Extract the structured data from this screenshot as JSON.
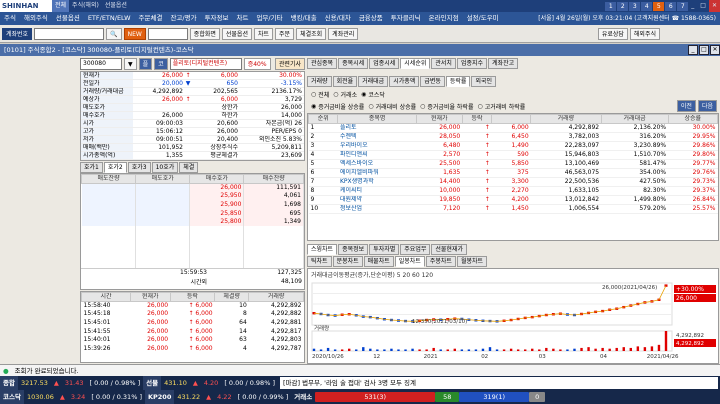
{
  "brand": {
    "logo": "SHINHAN",
    "tabs": [
      "전체",
      "주식(해외)",
      "선물옵션"
    ],
    "numbers": [
      "1",
      "2",
      "3",
      "4",
      "5",
      "6",
      "7"
    ]
  },
  "menu": [
    "주식",
    "해외주식",
    "선물옵션",
    "ETF/ETN/ELW",
    "주문체결",
    "잔고/평가",
    "투자정보",
    "차트",
    "업무/기타",
    "뱅킹/대출",
    "신용/대차",
    "금융상품",
    "투자클리닉",
    "온라인지점",
    "설정/도우미"
  ],
  "menu_extra": "[서울] 4월 26일(월) 오후 03:21:04 (고객지원센터 ☎ 1588-0365)",
  "toolbar": {
    "account_label": "계좌번호",
    "search_placeholder": "",
    "buttons": [
      "NEW",
      "종합화면",
      "선물옵션",
      "차트",
      "주문",
      "체결조회",
      "계좌관리",
      "유료상담",
      "해외주식"
    ]
  },
  "window_title": "[0101] 주식종합2 - [코스닥] 300080-플리토(디지털컨텐츠)-코스닥",
  "stock": {
    "code": "300080",
    "badge1": "플",
    "badge2": "코",
    "name": "플리토(디지털컨텐츠)",
    "margin": "증40%",
    "chart_btn": "관련기사"
  },
  "quote": [
    {
      "l": "현재가",
      "v": "26,000",
      "ar": "↑",
      "d": "6,000",
      "r": "30.00%"
    },
    {
      "l": "전일가",
      "v": "20,000",
      "ar": "▼",
      "d": "650",
      "r": "-3.15%"
    },
    {
      "l": "거래량/거래대금",
      "v": "4,292,892",
      "ar": "",
      "d": "202,565",
      "r": "2136.17%"
    },
    {
      "l": "예상가",
      "v": "26,000",
      "ar": "↑",
      "d": "6,000",
      "r": "3,729"
    },
    {
      "l": "매도호가",
      "v": "",
      "ar": "",
      "d": "상한가",
      "r": "26,000"
    },
    {
      "l": "매수호가",
      "v": "26,000",
      "ar": "",
      "d": "하한가",
      "r": "14,000"
    },
    {
      "l": "시가",
      "v": "09:00:03",
      "ar": "",
      "d": "20,600",
      "r": "자본금(억) 26"
    },
    {
      "l": "고가",
      "v": "15:06:12",
      "ar": "",
      "d": "26,000",
      "r": "PER/EPS 0"
    },
    {
      "l": "저가",
      "v": "09:00:51",
      "ar": "",
      "d": "20,400",
      "r": "외인소진 5.83%"
    },
    {
      "l": "매매(백만)",
      "v": "101,952",
      "ar": "",
      "d": "상장주식수",
      "r": "5,209,811"
    },
    {
      "l": "시가총액(억)",
      "v": "1,355",
      "ar": "",
      "d": "평균체결가",
      "r": "23,609"
    }
  ],
  "hoga_tabs": [
    "호가1",
    "호가2",
    "호가3",
    "10호가",
    "체결"
  ],
  "hoga_header": [
    "매도잔량",
    "매도호가",
    "매수호가",
    "매수잔량"
  ],
  "hoga_rows": [
    [
      "",
      "",
      "26,000",
      "111,591"
    ],
    [
      "",
      "",
      "25,950",
      "4,061"
    ],
    [
      "",
      "",
      "25,900",
      "1,698"
    ],
    [
      "",
      "",
      "25,850",
      "695"
    ],
    [
      "",
      "",
      "25,800",
      "1,349"
    ]
  ],
  "hoga_total": {
    "time": "15:59:53",
    "total": "127,325",
    "after": "시간외",
    "after_v": "48,109"
  },
  "trades_header": [
    "시간",
    "현재가",
    "등락",
    "체결량",
    "거래량"
  ],
  "trades": [
    [
      "15:58:40",
      "26,000",
      "↑ 6,000",
      "10",
      "4,292,892"
    ],
    [
      "15:45:18",
      "26,000",
      "↑ 6,000",
      "8",
      "4,292,882"
    ],
    [
      "15:45:01",
      "26,000",
      "↑ 6,000",
      "64",
      "4,292,881"
    ],
    [
      "15:41:55",
      "26,000",
      "↑ 6,000",
      "14",
      "4,292,817"
    ],
    [
      "15:40:01",
      "26,000",
      "↑ 6,000",
      "63",
      "4,292,803"
    ],
    [
      "15:39:26",
      "26,000",
      "↑ 6,000",
      "4",
      "4,292,787"
    ]
  ],
  "right_tabs": [
    "관심종목",
    "종목시세",
    "업종시세",
    "시세순위",
    "관서치",
    "업종지수",
    "계좌잔고"
  ],
  "rank_subtabs": [
    "거래량",
    "회전율",
    "거래대금",
    "시가총액",
    "급변동",
    "등락률",
    "외국인"
  ],
  "rank_filters": {
    "market": [
      "전체",
      "거래소",
      "코스닥"
    ],
    "cond": [
      "증거금비율 상승률",
      "거래대비 상승률",
      "증거금비율 하락률",
      "고거래비 하락률"
    ],
    "prev": "이전",
    "next": "다음"
  },
  "rank_header": [
    "순위",
    "종목명",
    "현재가",
    "등락",
    "",
    "거래량",
    "거래대금",
    "상승률"
  ],
  "rank_rows": [
    [
      "1",
      "플리토",
      "26,000",
      "↑",
      "6,000",
      "4,292,892",
      "2,136.20%",
      "30.00%"
    ],
    [
      "2",
      "수젠텍",
      "28,050",
      "↑",
      "6,450",
      "3,782,003",
      "316.20%",
      "29.95%"
    ],
    [
      "3",
      "우리바이오",
      "6,480",
      "↑",
      "1,490",
      "22,283,097",
      "3,230.89%",
      "29.86%"
    ],
    [
      "4",
      "파인디앤씨",
      "2,570",
      "↑",
      "590",
      "15,946,803",
      "1,510.70%",
      "29.80%"
    ],
    [
      "5",
      "엑세스바이오",
      "25,500",
      "↑",
      "5,850",
      "13,100,469",
      "581.47%",
      "29.77%"
    ],
    [
      "6",
      "에이치엘비파워",
      "1,635",
      "↑",
      "375",
      "46,563,075",
      "354.00%",
      "29.76%"
    ],
    [
      "7",
      "KPX생명과학",
      "14,400",
      "↑",
      "3,300",
      "22,500,536",
      "427.50%",
      "29.73%"
    ],
    [
      "8",
      "케이씨티",
      "10,000",
      "↑",
      "2,270",
      "1,633,105",
      "82.30%",
      "29.37%"
    ],
    [
      "9",
      "대원제약",
      "19,850",
      "↑",
      "4,200",
      "13,012,842",
      "1,499.80%",
      "26.84%"
    ],
    [
      "10",
      "청보산업",
      "7,120",
      "↑",
      "1,450",
      "1,006,554",
      "579.20%",
      "25.57%"
    ]
  ],
  "chart_tabs": [
    "스윙차트",
    "종목정보",
    "투자자별",
    "주요업무",
    "선물현재가"
  ],
  "chart_subtabs": [
    "틱차트",
    "분봉차트",
    "매물차트",
    "일봉차트",
    "주봉차트",
    "월봉차트"
  ],
  "chart_legend": "거래대금이동평균(증가,단순이평) 5 20 60 120",
  "chart_data": {
    "type": "line",
    "series": [
      {
        "name": "",
        "values": [
          15.5,
          15.2,
          14.8,
          14.6,
          14.9,
          15.1,
          14.7,
          14.2,
          14.0,
          13.6,
          13.2,
          12.9,
          12.7,
          12.5,
          12.4,
          12.6,
          12.9,
          13.1,
          13.0,
          13.2,
          13.4,
          13.3,
          13.0,
          12.8,
          12.6,
          12.5,
          12.4,
          12.6,
          12.9,
          13.3,
          13.7,
          14.0,
          14.4,
          14.8,
          15.1,
          15.3,
          15.0,
          14.8,
          15.2,
          15.6,
          16.0,
          16.3,
          16.8,
          17.2,
          17.8,
          18.4,
          19.0,
          19.6,
          20.0,
          20.6,
          26.0
        ]
      }
    ],
    "volumes": [
      3,
      2,
      4,
      2,
      2,
      3,
      2,
      5,
      3,
      2,
      2,
      3,
      2,
      2,
      3,
      2,
      2,
      4,
      2,
      2,
      3,
      2,
      2,
      2,
      3,
      5,
      2,
      2,
      3,
      2,
      2,
      3,
      2,
      4,
      3,
      2,
      2,
      3,
      4,
      5,
      3,
      4,
      3,
      4,
      5,
      4,
      6,
      5,
      6,
      8,
      26
    ],
    "x_ticks": [
      "2020/10/26",
      "12",
      "2021",
      "02",
      "03",
      "04",
      "2021/04/26"
    ],
    "annotations": [
      "26,000(2021/04/26)",
      "12,350(2021/03/10)"
    ],
    "price_label1": "+30.00%",
    "price_label2": "26,000",
    "vol_label": "거래량",
    "vol_side1": "4,292,892",
    "vol_side2": "4,292,892"
  },
  "status": "조회가 완료되었습니다.",
  "bottom1": [
    {
      "k": "종합",
      "v": "3217.53",
      "ar": "▲",
      "d": "31.43",
      "p": "[ 0.00 / 0.98% ]"
    },
    {
      "k": "선물",
      "v": "431.10",
      "ar": "▲",
      "d": "4.20",
      "p": "[ 0.00 / 0.98% ]"
    }
  ],
  "bottom1_msg": "[마감] 법무부, '라임 술 접대' 검사 3명 모두 징계",
  "bottom2": [
    {
      "k": "코스닥",
      "v": "1030.06",
      "ar": "▲",
      "d": "3.24",
      "p": "[ 0.00 / 0.31% ]"
    },
    {
      "k": "KP200",
      "v": "431.22",
      "ar": "▲",
      "d": "4.22",
      "p": "[ 0.00 / 0.99% ]"
    }
  ],
  "bottom2_exch": "거래소",
  "bottom2_up": "531(3)",
  "bottom2_mid": "58",
  "bottom2_down": "319(1)",
  "bottom2_flat": "0"
}
